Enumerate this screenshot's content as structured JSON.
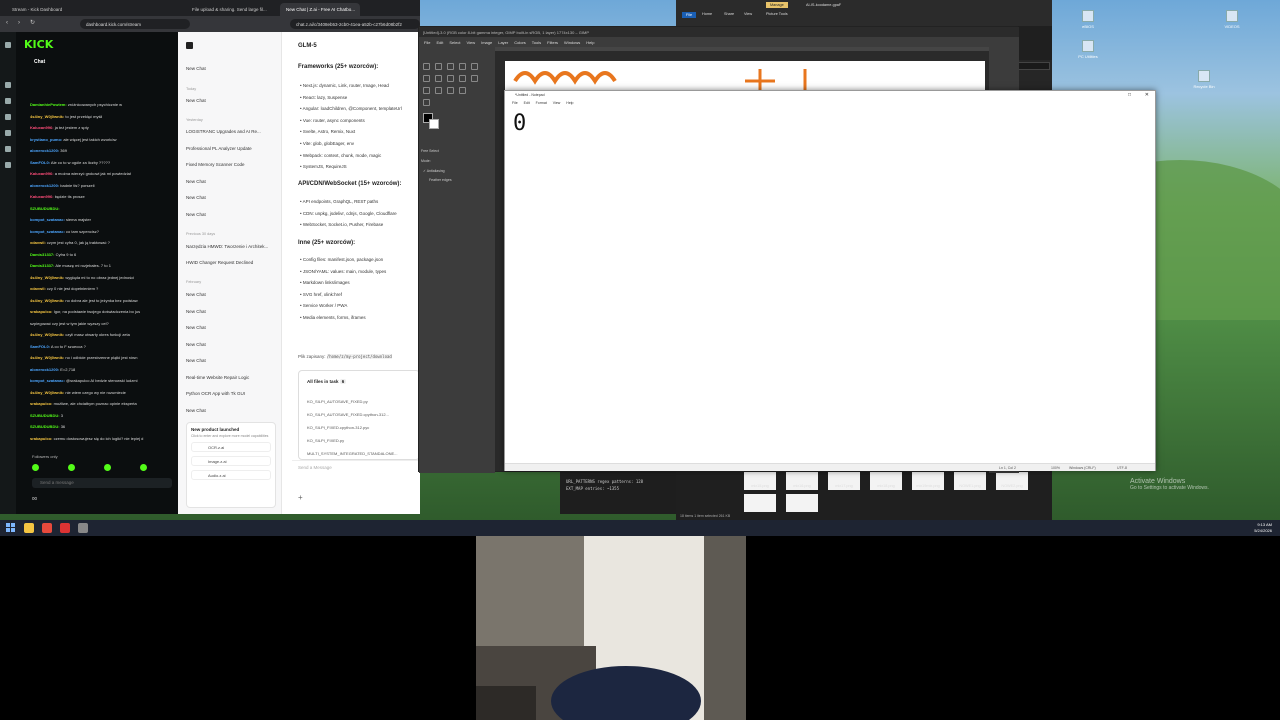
{
  "chrome": {
    "tabs": [
      "Stream - Kick Dashboard",
      "File upload & sharing. Send large fil...",
      "New Chat | Z.ai - Free AI Chatbo..."
    ],
    "url": "dashboard.kick.com/stream",
    "url2": "chat.z.ai/c/3408eb53-2cb0-41ea-a52b-c27b6d08b2f2"
  },
  "kick": {
    "logo": "KICK",
    "chat_title": "Chat",
    "messages": [
      {
        "user": "DamianhiePowiem:",
        "text": "zróżnicowanych psychicznie w",
        "color": "#53fc18"
      },
      {
        "user": "4s4iny_W0j0wnik:",
        "text": "to jest przeklęć myśli",
        "color": "#f5c542"
      },
      {
        "user": "Kaluxan996:",
        "text": "ja też jestem z spty",
        "color": "#ff4d7a"
      },
      {
        "user": "krystiano_pumo:",
        "text": "ale więcej jest takich wzorków",
        "color": "#4da6ff"
      },
      {
        "user": "alonerock1200:",
        "text": "369",
        "color": "#4da6ff"
      },
      {
        "user": "SamFOL0:",
        "text": "Ale co to w ogóle za liczby ?????",
        "color": "#4da6ff"
      },
      {
        "user": "Kaluxan996:",
        "text": "a można wierzyć grokowi jak mi powiedział",
        "color": "#ff4d7a"
      },
      {
        "user": "alonerock1200:",
        "text": "badnie tls? porszeli",
        "color": "#4da6ff"
      },
      {
        "user": "Kaluxan996:",
        "text": "będzie tls prosze",
        "color": "#ff4d7a"
      },
      {
        "user": "SZUBUDUBDU:",
        "text": "",
        "color": "#53fc18"
      },
      {
        "user": "kompot_szatanac:",
        "text": "siema majster",
        "color": "#4da6ff"
      },
      {
        "user": "kompot_szatanac:",
        "text": "co tam szpencisz?",
        "color": "#4da6ff"
      },
      {
        "user": "xdavwil:",
        "text": "czym jest cyfra 0, jak ją traktować ?",
        "color": "#f5c542"
      },
      {
        "user": "Damis31337:",
        "text": "Cyfra 9 to 6",
        "color": "#53fc18"
      },
      {
        "user": "Damis31337:",
        "text": "Ale muszę mi rozjebałes. 7 to 1",
        "color": "#53fc18"
      },
      {
        "user": "4s4iny_W0j0wnik:",
        "text": "wygląda mi to no obraz jednej jedności",
        "color": "#f5c542"
      },
      {
        "user": "xdavwil:",
        "text": "czy 0 nie jest dopełnieniem ?",
        "color": "#f5c542"
      },
      {
        "user": "4s4iny_W0j0wnik:",
        "text": "no dobra ale jest to jeżynka bez podstaw",
        "color": "#f5c542"
      },
      {
        "user": "srakapulco:",
        "text": "Igor, na podstawie twojego doświadczenia bo jus",
        "color": "#f5c542"
      },
      {
        "user": "",
        "text": "szpiegować czy jest w tym jakie wyzszy cel?",
        "color": "#ddd"
      },
      {
        "user": "4s4iny_W0j0wnik:",
        "text": "czyli masz otwarty okres funkcji zeta",
        "color": "#f5c542"
      },
      {
        "user": "SamFOL0:",
        "text": "A co to F szuecca ?",
        "color": "#4da6ff"
      },
      {
        "user": "4s4iny_W0j0wnik:",
        "text": "no i odbicie przestrzenne plątki jest równ",
        "color": "#f5c542"
      },
      {
        "user": "alonerock1200:",
        "text": "E=2,718",
        "color": "#4da6ff"
      },
      {
        "user": "kompot_szatanac:",
        "text": "@srakapulco AI bedzie sterowski ludzmi",
        "color": "#4da6ff"
      },
      {
        "user": "4s4iny_W0j0wnik:",
        "text": "nie wiem czego wy nie rozumiecie",
        "color": "#f5c542"
      },
      {
        "user": "srakapulco:",
        "text": "możliwe, ale chciałbym poznac opinie eksperta",
        "color": "#f5c542"
      },
      {
        "user": "SZUBUDUBDU:",
        "text": "3",
        "color": "#53fc18"
      },
      {
        "user": "SZUBUDUBDU:",
        "text": "36",
        "color": "#53fc18"
      },
      {
        "user": "srakapulco:",
        "text": "czemu dostosowujesz się do ich logiki? nie lepiej d",
        "color": "#f5c542"
      }
    ],
    "followers": "Followers only",
    "send_placeholder": "Send a message",
    "footer_count": "00"
  },
  "zai": {
    "new_chat": "New Chat",
    "groups": {
      "today": "Today",
      "yesterday": "Yesterday",
      "previous_30": "Previous 30 days",
      "february": "February"
    },
    "items_today": [
      "New Chat"
    ],
    "items_week": [
      "LOGISTRANC Upgrades and AI Re...",
      "Professional PL Analyzer Update",
      "Fixed Memory Scanner Code",
      "New Chat",
      "New Chat",
      "New Chat"
    ],
    "items_30": [
      "Narzędzia HMWD: Tworzenie i Architek...",
      "HWID Changer Request Declined"
    ],
    "items_feb": [
      "New Chat",
      "New Chat",
      "New Chat",
      "New Chat",
      "New Chat",
      "Real-time Website Repair Logic",
      "Python OCR App with Tk GUI",
      "New Chat"
    ],
    "card": {
      "title": "New product launched",
      "desc": "Click to enter and explore more model capabilities",
      "products": [
        "OCR.z.ai",
        "Image.z.ai",
        "Audio.z.ai"
      ]
    },
    "model": "GLM-5",
    "h1": "Frameworks (25+ wzorców):",
    "list1": [
      "Next.js: dynamic, Link, router, Image, Head",
      "React: lazy, Suspense",
      "Angular: loadChildren, @Component, templateUrl",
      "Vue: router, async components",
      "Svelte, Astro, Remix, Nuxt",
      "Vite: glob, globEager, env",
      "Webpack: context, chunk, mode, magic",
      "SystemJS, RequireJS"
    ],
    "h2": "API/CDN/WebSocket (15+ wzorców):",
    "list2": [
      "API endpoints, GraphQL, REST paths",
      "CDN: unpkg, jsdelivr, cdnjs, Google, Cloudflare",
      "WebSocket, Socket.io, Pusher, Firebase"
    ],
    "h3": "Inne (25+ wzorców):",
    "list3": [
      "Config files: manifest.json, package.json",
      "JSON/YAML: values: main, module, types",
      "Markdown links/images",
      "SVG href, xlink:href",
      "Service Worker / PWA",
      "Media elements, forms, iframes"
    ],
    "save_prefix": "Plik zapisany:",
    "save_path": "/home/z/my-project/download",
    "files_title": "All files in task",
    "files_count": "6",
    "files": [
      "KO_SILPI_AUTOSAVE_FIXED.py",
      "KO_SILPI_AUTOSAVE_FIXED.cpython-312...",
      "KO_SILPI_FIXED.cpython-312.pyc",
      "KO_SILPI_FIXED.py",
      "MULTI_SYSTEM_INTEGRATED_STANDALONE..."
    ],
    "send_placeholder": "Send a Message"
  },
  "gimp": {
    "title": "[Untitled]-3.0 (RGB color 8-bit gamma integer, GIMP built-in sRGB, 1 layer) 1774x130 – GIMP",
    "menu": [
      "File",
      "Edit",
      "Select",
      "View",
      "Image",
      "Layer",
      "Colors",
      "Tools",
      "Filters",
      "Windows",
      "Help"
    ],
    "tool_options": [
      "Free Select",
      "Mode:",
      "Antialiasing",
      "Feather edges"
    ]
  },
  "notepad": {
    "title": "*Untitled - Notepad",
    "menu": [
      "File",
      "Edit",
      "Format",
      "View",
      "Help"
    ],
    "text": "0",
    "status": [
      "Ln 1, Col 2",
      "100%",
      "Windows (CRLF)",
      "UTF-8"
    ]
  },
  "explorer": {
    "tabs": [
      "File",
      "Home",
      "Share",
      "View",
      "Picture Tools"
    ],
    "manage": "Manage",
    "title": "AI-IS-koodame-gpaF",
    "thumbs": [
      "mix15.png",
      "mix16.png",
      "mix17.png",
      "mix18.png",
      "mix19mix.png",
      "NOWE1.png",
      "NOWE2.png"
    ],
    "status": "18 items    1 item selected  261 KB",
    "search": "Filter"
  },
  "terminal": {
    "lines": [
      "URL_PATTERNS regex patterns: 128",
      "EXT_MAP entries: ~1355"
    ]
  },
  "desktop": {
    "icons": [
      "eBIOS",
      "VIDEOS",
      "PC Utilities",
      "Recycle Bin"
    ],
    "watermark_title": "Activate Windows",
    "watermark_sub": "Go to Settings to activate Windows."
  },
  "taskbar": {
    "time": "9:13 AM",
    "date": "5/24/2026"
  }
}
